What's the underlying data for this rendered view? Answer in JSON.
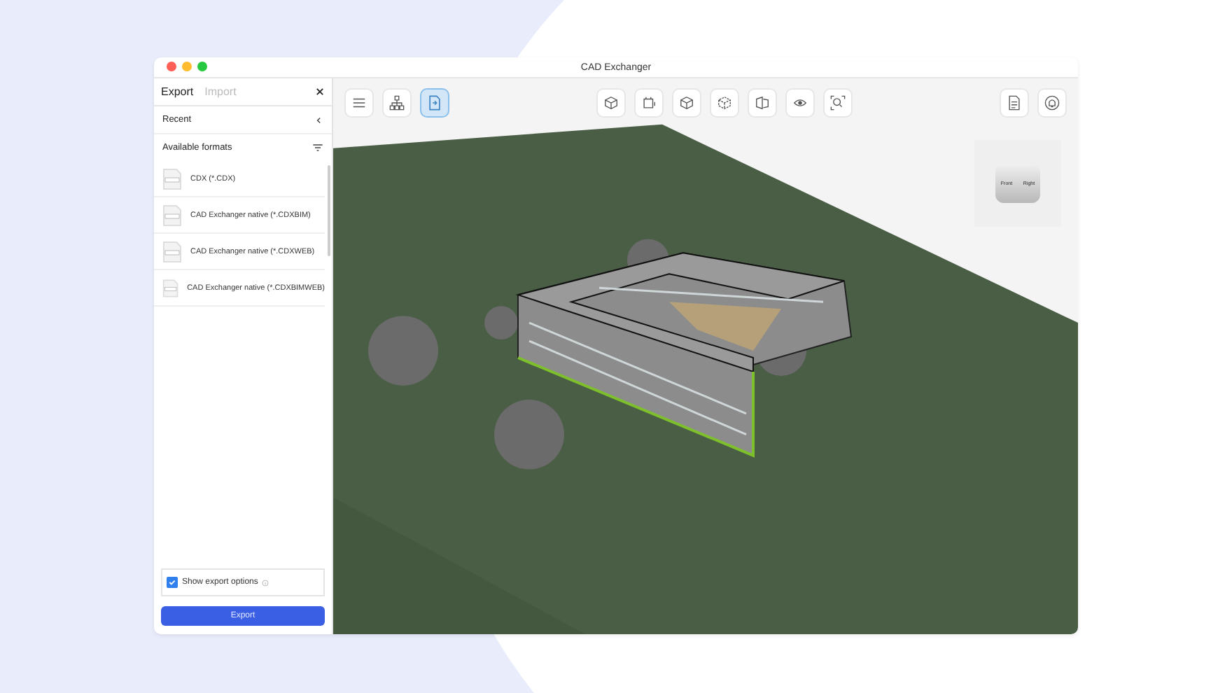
{
  "window": {
    "title": "CAD Exchanger"
  },
  "panel": {
    "tabs": [
      {
        "label": "Export",
        "selected": true
      },
      {
        "label": "Import",
        "selected": false
      }
    ],
    "recent": {
      "label": "Recent",
      "expanded": false
    },
    "formats_heading": "Available formats",
    "formats": [
      {
        "label": "CDX (*.CDX)"
      },
      {
        "label": "CAD Exchanger native (*.CDXBIM)"
      },
      {
        "label": "CAD Exchanger native (*.CDXWEB)"
      },
      {
        "label": "CAD Exchanger native (*.CDXBIMWEB)"
      }
    ],
    "show_options": {
      "label": "Show export options",
      "checked": true
    },
    "export_button": "Export"
  },
  "toolbar": {
    "left": [
      {
        "kind": "menu",
        "selected": false
      },
      {
        "kind": "tree",
        "selected": false
      },
      {
        "kind": "export",
        "selected": true
      }
    ],
    "center": [
      {
        "kind": "cube-iso",
        "selected": false
      },
      {
        "kind": "section",
        "selected": false
      },
      {
        "kind": "cube-solid",
        "selected": false
      },
      {
        "kind": "cube-wire",
        "selected": false
      },
      {
        "kind": "explode",
        "selected": false
      },
      {
        "kind": "eye",
        "selected": false
      },
      {
        "kind": "zoom",
        "selected": false
      }
    ],
    "right": [
      {
        "kind": "document",
        "selected": false
      },
      {
        "kind": "bell",
        "selected": false
      }
    ]
  },
  "view_cube": {
    "faces": [
      "Front",
      "Right"
    ]
  }
}
